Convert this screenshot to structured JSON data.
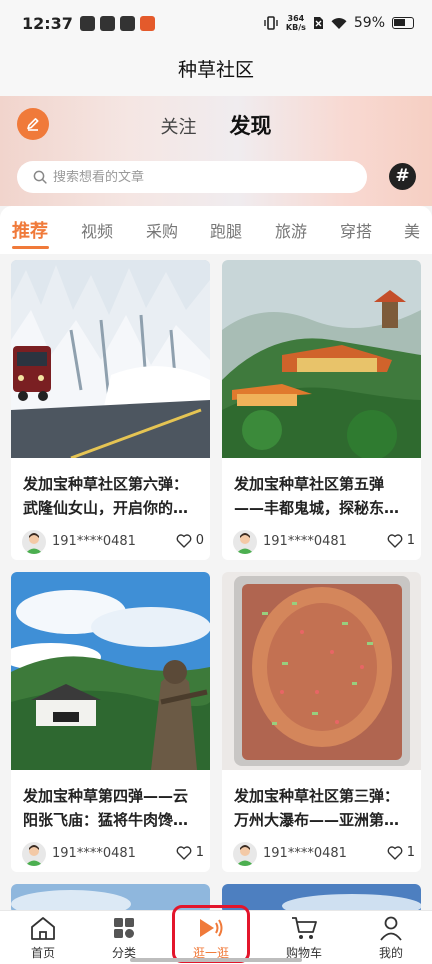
{
  "status": {
    "time": "12:37",
    "net_speed_value": "364",
    "net_speed_unit": "KB/s",
    "battery": "59%"
  },
  "header": {
    "title": "种草社区"
  },
  "top_tabs": [
    {
      "label": "关注",
      "active": false
    },
    {
      "label": "发现",
      "active": true
    }
  ],
  "search": {
    "placeholder": "搜索想看的文章"
  },
  "hash_label": "#",
  "categories": [
    {
      "label": "推荐",
      "active": true
    },
    {
      "label": "视频"
    },
    {
      "label": "采购"
    },
    {
      "label": "跑腿"
    },
    {
      "label": "旅游"
    },
    {
      "label": "穿搭"
    },
    {
      "label": "美"
    }
  ],
  "posts": [
    {
      "title": "发加宝种草社区第六弹：武隆仙女山，开启你的…",
      "user": "191****0481",
      "likes": "0",
      "image": "snowy-forest-train"
    },
    {
      "title": "发加宝种草社区第五弹——丰都鬼城，探秘东…",
      "user": "191****0481",
      "likes": "1",
      "image": "temple-on-hill"
    },
    {
      "title": "发加宝种草第四弹——云阳张飞庙：猛将牛肉馋…",
      "user": "191****0481",
      "likes": "1",
      "image": "mountain-gate-statue"
    },
    {
      "title": "发加宝种草社区第三弹：万州大瀑布——亚洲第…",
      "user": "191****0481",
      "likes": "1",
      "image": "grilled-fish-dish"
    }
  ],
  "tabbar": [
    {
      "label": "首页",
      "icon": "home-icon",
      "active": false
    },
    {
      "label": "分类",
      "icon": "category-icon",
      "active": false
    },
    {
      "label": "逛一逛",
      "icon": "play-icon",
      "active": true
    },
    {
      "label": "购物车",
      "icon": "cart-icon",
      "active": false
    },
    {
      "label": "我的",
      "icon": "user-icon",
      "active": false
    }
  ],
  "colors": {
    "accent": "#f07a3a",
    "highlight_box": "#e3152b"
  }
}
